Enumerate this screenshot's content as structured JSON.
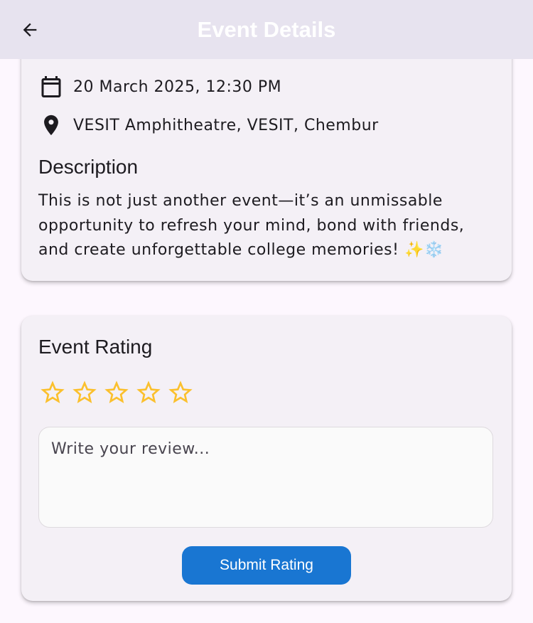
{
  "appbar": {
    "title": "Event Details",
    "back_icon": "arrow-back-icon",
    "background_color": "#e7e3ef"
  },
  "event": {
    "date_icon": "calendar-icon",
    "date_time": "20 March 2025, 12:30 PM",
    "location_icon": "location-pin-icon",
    "location": "VESIT Amphitheatre, VESIT, Chembur",
    "description_title": "Description",
    "description_text": "This is not just another event—it’s an unmissable opportunity to refresh your mind, bond with friends, and create unforgettable college memories!",
    "description_emoji": "✨❄️"
  },
  "rating": {
    "title": "Event Rating",
    "stars_total": 5,
    "stars_selected": 0,
    "star_color": "#fbc02d",
    "star_icon": "star-outline-icon",
    "review_placeholder": "Write your review...",
    "review_value": "",
    "submit_label": "Submit Rating",
    "submit_color": "#1976d2"
  }
}
